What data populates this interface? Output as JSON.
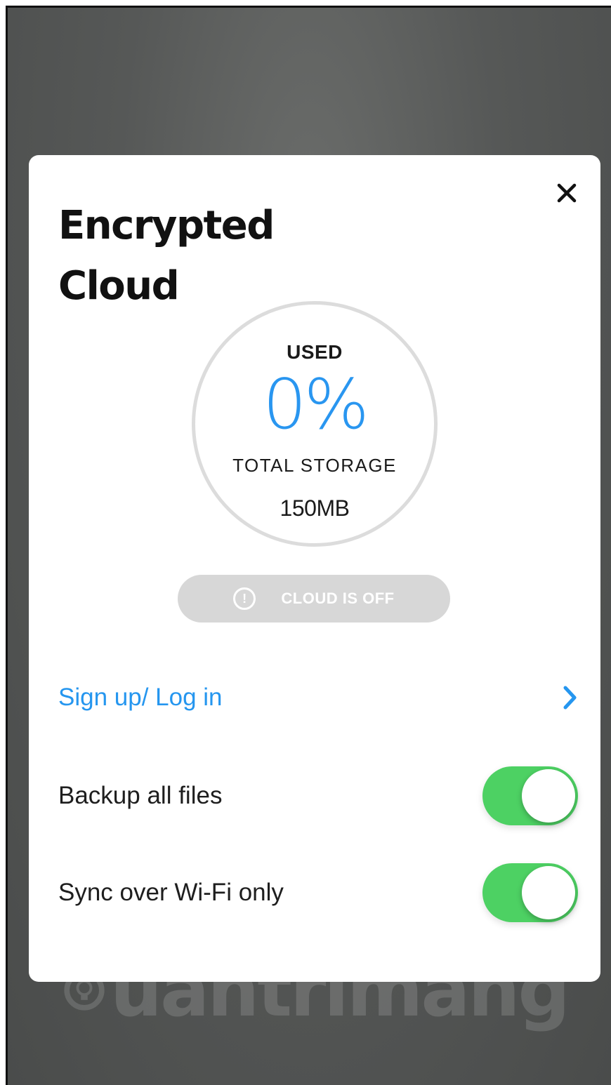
{
  "modal": {
    "title": "Encrypted Cloud",
    "close_icon": "close-icon"
  },
  "storage": {
    "used_label": "USED",
    "used_value": "0%",
    "used_fraction": 0,
    "total_label": "TOTAL STORAGE",
    "total_value": "150MB"
  },
  "cloud_status": {
    "icon": "alert-circle-icon",
    "label": "CLOUD IS OFF"
  },
  "account": {
    "signin_label": "Sign up/ Log in",
    "chevron_icon": "chevron-right-icon"
  },
  "settings": {
    "backup_label": "Backup all files",
    "backup_on": true,
    "sync_label": "Sync over Wi-Fi only",
    "sync_on": true
  },
  "watermark": {
    "text": "uantrimang"
  },
  "colors": {
    "accent_blue": "#2996f0",
    "toggle_green": "#4dd163",
    "status_gray": "#d7d7d7"
  }
}
